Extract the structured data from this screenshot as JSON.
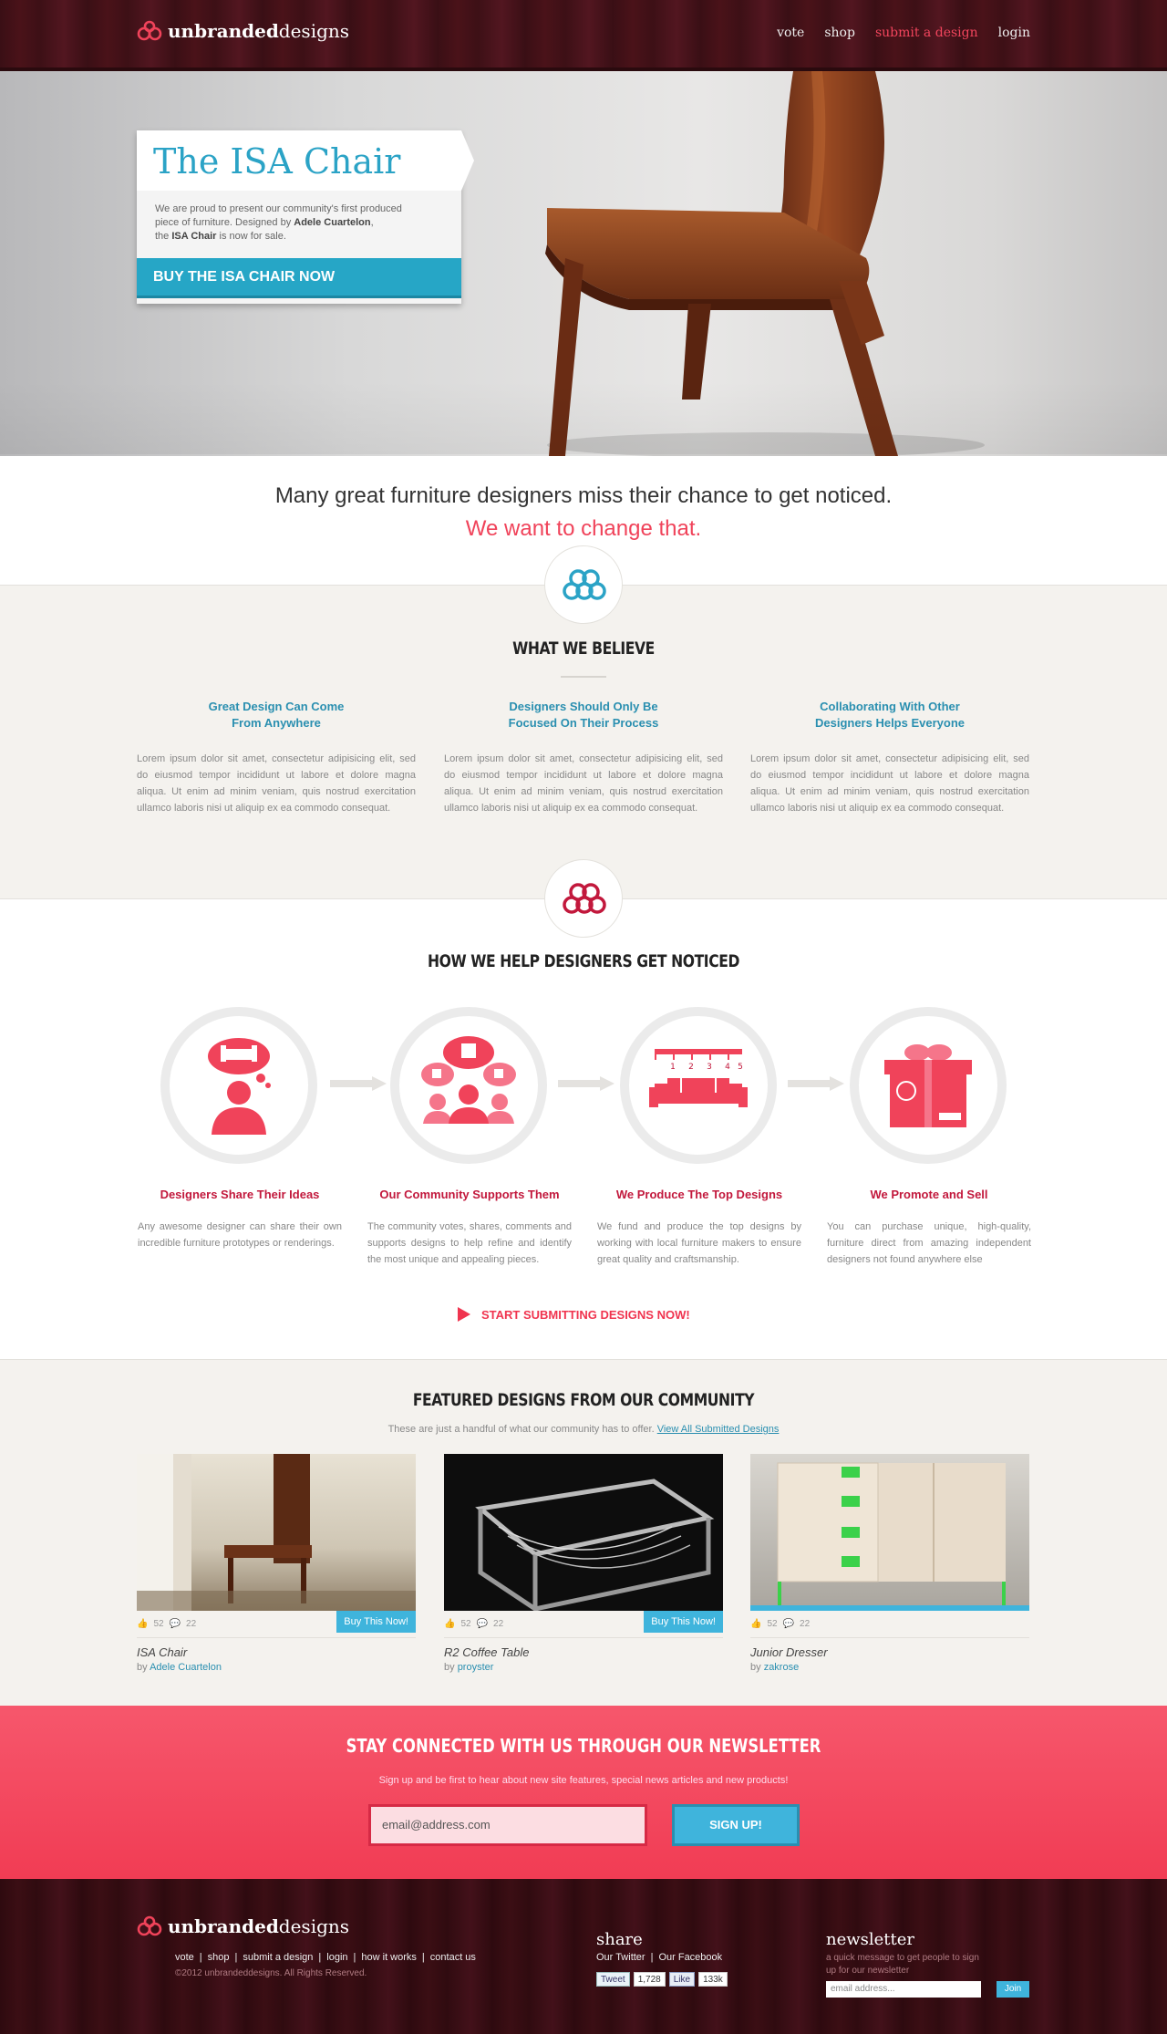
{
  "header": {
    "logo_bold": "unbranded",
    "logo_rest": "designs",
    "nav": [
      {
        "label": "vote"
      },
      {
        "label": "shop"
      },
      {
        "label": "submit a design"
      },
      {
        "label": "login"
      }
    ]
  },
  "hero": {
    "title": "The ISA Chair",
    "body_pre": "We are proud to present our community's first produced piece of furniture. Designed by ",
    "designer": "Adele Cuartelon",
    "body_mid": ",",
    "body_the": "the ",
    "product": "ISA Chair",
    "body_end": " is now for sale.",
    "cta": "BUY THE ISA CHAIR NOW"
  },
  "intro": {
    "line1": "Many great furniture designers miss their chance to get noticed.",
    "line2": "We want to change that."
  },
  "believe": {
    "title": "WHAT WE BELIEVE",
    "cols": [
      {
        "h1": "Great Design Can Come",
        "h2": "From Anywhere",
        "body": "Lorem ipsum dolor sit amet, consectetur adipisicing elit, sed do eiusmod tempor incididunt ut labore et dolore magna aliqua. Ut enim ad minim veniam, quis nostrud exercitation ullamco laboris nisi ut aliquip ex ea commodo consequat."
      },
      {
        "h1": "Designers Should Only Be",
        "h2": "Focused On Their Process",
        "body": "Lorem ipsum dolor sit amet, consectetur adipisicing elit, sed do eiusmod tempor incididunt ut labore et dolore magna aliqua. Ut enim ad minim veniam, quis nostrud exercitation ullamco laboris nisi ut aliquip ex ea commodo consequat."
      },
      {
        "h1": "Collaborating With Other",
        "h2": "Designers Helps Everyone",
        "body": "Lorem ipsum dolor sit amet, consectetur adipisicing elit, sed do eiusmod tempor incididunt ut labore et dolore magna aliqua. Ut enim ad minim veniam, quis nostrud exercitation ullamco laboris nisi ut aliquip ex ea commodo consequat."
      }
    ]
  },
  "how": {
    "title": "HOW WE HELP DESIGNERS GET NOTICED",
    "ruler": [
      "1",
      "2",
      "3",
      "4",
      "5"
    ],
    "steps": [
      {
        "h": "Designers Share Their Ideas",
        "body": "Any awesome designer can share their own incredible furniture prototypes or renderings."
      },
      {
        "h": "Our Community Supports Them",
        "body": "The community votes, shares, comments and supports designs to help refine and identify the most unique and appealing pieces."
      },
      {
        "h": "We Produce The Top Designs",
        "body": "We fund and produce the top designs by working with local furniture makers to ensure great quality and craftsmanship."
      },
      {
        "h": "We Promote and Sell",
        "body": "You can purchase unique, high-quality, furniture direct from amazing independent designers not found anywhere else"
      }
    ],
    "cta": "START SUBMITTING DESIGNS NOW!"
  },
  "featured": {
    "title": "FEATURED DESIGNS FROM OUR COMMUNITY",
    "subtitle": "These are just a handful of what our community has to offer.",
    "link": "View All Submitted Designs",
    "items": [
      {
        "name": "ISA Chair",
        "by": "by ",
        "author": "Adele Cuartelon",
        "likes": "52",
        "comments": "22",
        "buy": "Buy This Now!"
      },
      {
        "name": "R2 Coffee Table",
        "by": "by ",
        "author": "proyster",
        "likes": "52",
        "comments": "22",
        "buy": "Buy This Now!"
      },
      {
        "name": "Junior Dresser",
        "by": "by ",
        "author": "zakrose",
        "likes": "52",
        "comments": "22",
        "buy": ""
      }
    ]
  },
  "newsletter": {
    "title": "STAY CONNECTED WITH US THROUGH OUR NEWSLETTER",
    "subtitle": "Sign up and be first to hear about new site features, special news articles and new products!",
    "email_value": "email@address.com",
    "button": "SIGN UP!"
  },
  "footer": {
    "logo_bold": "unbranded",
    "logo_rest": "designs",
    "links": [
      {
        "label": "vote"
      },
      {
        "label": "shop"
      },
      {
        "label": "submit a design"
      },
      {
        "label": "login"
      },
      {
        "label": "how it works"
      },
      {
        "label": "contact us"
      }
    ],
    "sep": "|",
    "copyright": "©2012 unbrandeddesigns. All Rights Reserved.",
    "share_title": "share",
    "twitter": "Our Twitter",
    "facebook": "Our Facebook",
    "tweet": "Tweet",
    "tweet_count": "1,728",
    "like": "Like",
    "like_count": "133k",
    "news_title": "newsletter",
    "news_sub": "a quick message to get people to sign up for our newsletter",
    "news_placeholder": "email address...",
    "join": "Join"
  },
  "colors": {
    "brand_red": "#f0435a",
    "brand_blue": "#2ba3c6",
    "crimson": "#c2183c",
    "wood": "#4a1219"
  }
}
